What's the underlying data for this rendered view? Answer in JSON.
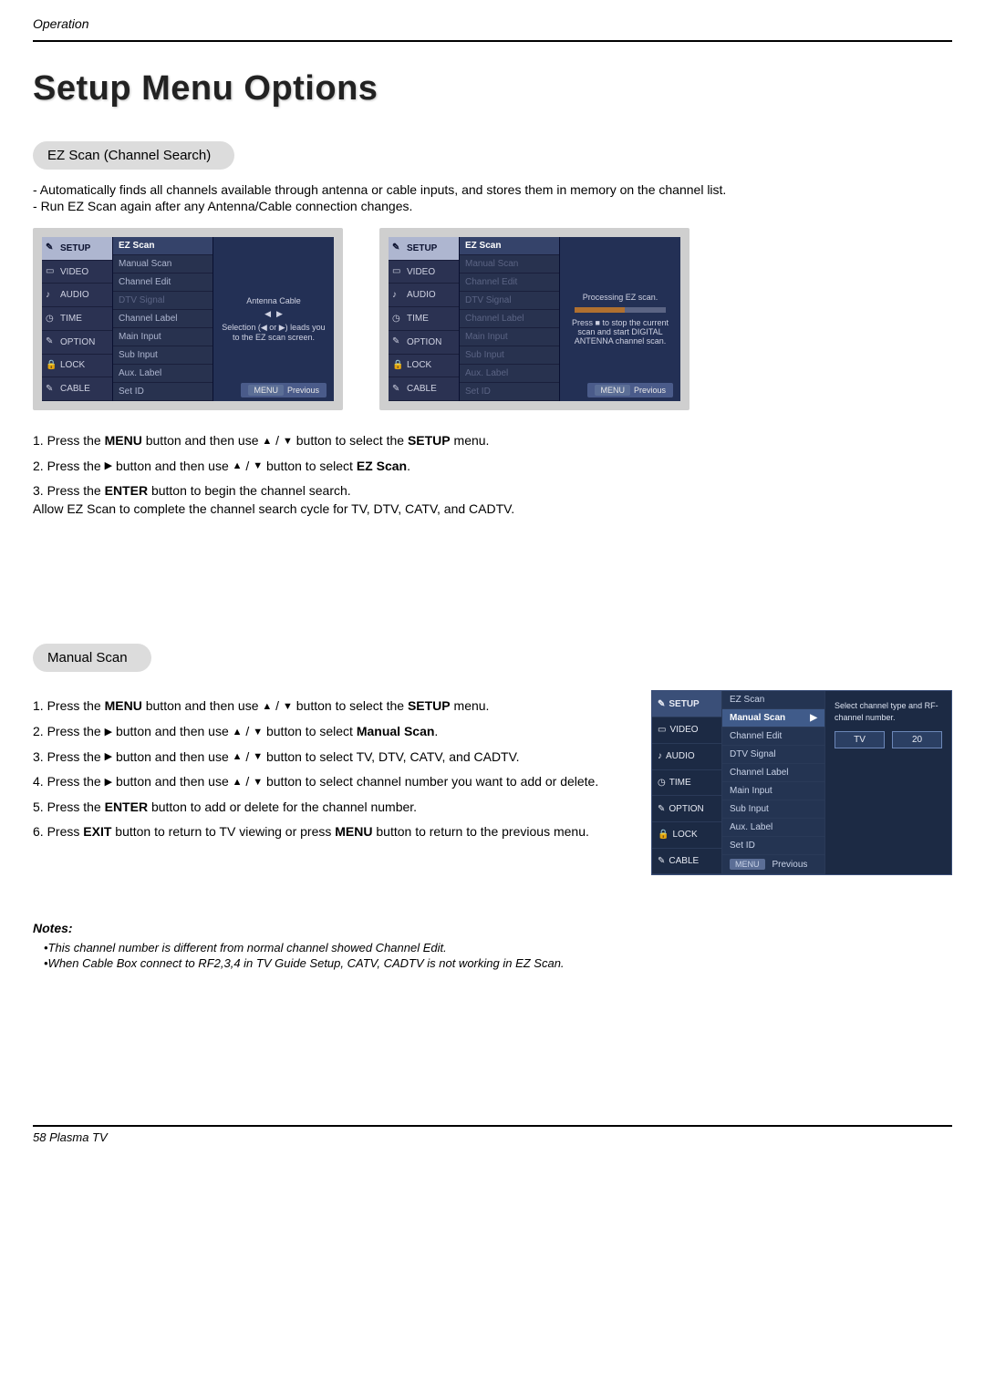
{
  "header_category": "Operation",
  "page_title": "Setup Menu Options",
  "ez_scan": {
    "pill": "EZ Scan (Channel Search)",
    "bullets": [
      "Automatically finds all channels available through antenna or cable inputs, and stores them in memory on the channel list.",
      "Run EZ Scan again after any Antenna/Cable connection changes."
    ],
    "steps": {
      "s1a": "Press the ",
      "s1b": "MENU",
      "s1c": " button and then use ",
      "s1d": " button to select the ",
      "s1e": "SETUP",
      "s1f": " menu.",
      "s2a": "Press the ",
      "s2b": " button and then use ",
      "s2c": " button to select ",
      "s2d": "EZ Scan",
      "s2e": ".",
      "s3a": "Press the ",
      "s3b": "ENTER",
      "s3c": " button to begin the channel search.",
      "s3d": "Allow EZ Scan to complete the channel search cycle for TV, DTV, CATV, and CADTV."
    },
    "shot_items": {
      "sidebar": [
        "SETUP",
        "VIDEO",
        "AUDIO",
        "TIME",
        "OPTION",
        "LOCK",
        "CABLE"
      ],
      "menu": [
        "EZ Scan",
        "Manual Scan",
        "Channel Edit",
        "DTV Signal",
        "Channel Label",
        "Main Input",
        "Sub Input",
        "Aux. Label",
        "Set ID"
      ],
      "prev": "Previous",
      "menu_key": "MENU",
      "r1_hint_a": "Antenna    Cable",
      "r1_hint_b": "Selection (◀ or ▶) leads you to the EZ scan screen.",
      "r2_hint_a": "Processing EZ scan.",
      "r2_hint_b": "Press ■ to stop the current scan and start DIGITAL ANTENNA channel scan."
    }
  },
  "manual": {
    "pill": "Manual Scan",
    "steps": {
      "s1a": "Press the ",
      "s1b": "MENU",
      "s1c": " button and then use ",
      "s1d": " button to select the ",
      "s1e": "SETUP",
      "s1f": " menu.",
      "s2a": "Press the ",
      "s2b": " button and then use ",
      "s2c": " button to select ",
      "s2d": "Manual Scan",
      "s2e": ".",
      "s3a": "Press the ",
      "s3b": " button and then use ",
      "s3c": " button to select TV, DTV, CATV, and CADTV.",
      "s4a": "Press the ",
      "s4b": " button and then use ",
      "s4c": " button to select channel number you want to add or delete.",
      "s5a": "Press the ",
      "s5b": "ENTER",
      "s5c": " button to add or delete for the channel number.",
      "s6a": "Press ",
      "s6b": "EXIT",
      "s6c": " button to return to TV viewing or press ",
      "s6d": "MENU",
      "s6e": " button to return to the previous menu."
    },
    "shot": {
      "sidebar": [
        "SETUP",
        "VIDEO",
        "AUDIO",
        "TIME",
        "OPTION",
        "LOCK",
        "CABLE"
      ],
      "menu": [
        "EZ Scan",
        "Manual Scan",
        "Channel Edit",
        "DTV Signal",
        "Channel Label",
        "Main Input",
        "Sub Input",
        "Aux. Label",
        "Set ID"
      ],
      "hint": "Select channel type and RF-channel number.",
      "box1": "TV",
      "box2": "20",
      "menu_key": "MENU",
      "prev": "Previous"
    }
  },
  "notes": {
    "heading": "Notes:",
    "n1": "•This channel number is different from normal channel showed Channel Edit.",
    "n2": "•When Cable Box connect to RF2,3,4 in TV Guide Setup, CATV, CADTV is not working in EZ Scan."
  },
  "footer": "58  Plasma TV",
  "glyph": {
    "up": "▲",
    "down": "▼",
    "right": "▶",
    "slash": " / "
  }
}
